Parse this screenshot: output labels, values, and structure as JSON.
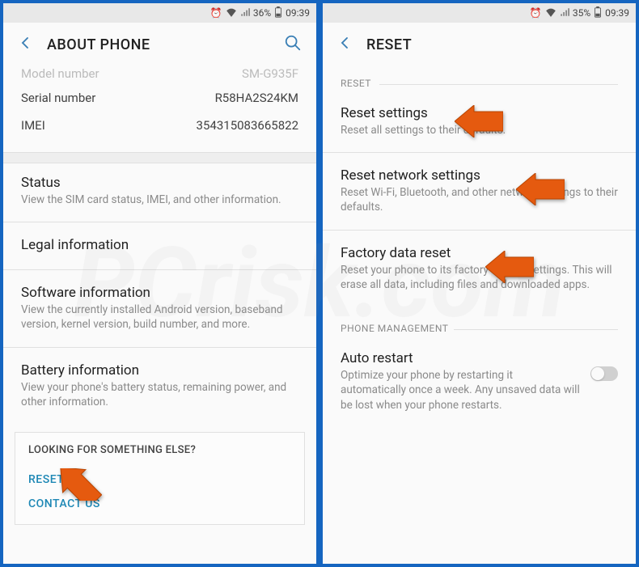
{
  "left": {
    "status": {
      "battery": "36%",
      "time": "09:39"
    },
    "title": "ABOUT PHONE",
    "rows": [
      {
        "label": "Model number",
        "value": "SM-G935F"
      },
      {
        "label": "Serial number",
        "value": "R58HA2S24KM"
      },
      {
        "label": "IMEI",
        "value": "354315083665822"
      }
    ],
    "items": [
      {
        "title": "Status",
        "desc": "View the SIM card status, IMEI, and other information."
      },
      {
        "title": "Legal information",
        "desc": ""
      },
      {
        "title": "Software information",
        "desc": "View the currently installed Android version, baseband version, kernel version, build number, and more."
      },
      {
        "title": "Battery information",
        "desc": "View your phone's battery status, remaining power, and other information."
      }
    ],
    "card": {
      "header": "LOOKING FOR SOMETHING ELSE?",
      "links": [
        "RESET",
        "CONTACT US"
      ]
    }
  },
  "right": {
    "status": {
      "battery": "35%",
      "time": "09:39"
    },
    "title": "RESET",
    "section1": "RESET",
    "items": [
      {
        "title": "Reset settings",
        "desc": "Reset all settings to their defaults."
      },
      {
        "title": "Reset network settings",
        "desc": "Reset Wi-Fi, Bluetooth, and other network settings to their defaults."
      },
      {
        "title": "Factory data reset",
        "desc": "Reset your phone to its factory default settings. This will erase all data, including files and downloaded apps."
      }
    ],
    "section2": "PHONE MANAGEMENT",
    "auto": {
      "title": "Auto restart",
      "desc": "Optimize your phone by restarting it automatically once a week. Any unsaved data will be lost when your phone restarts."
    }
  }
}
